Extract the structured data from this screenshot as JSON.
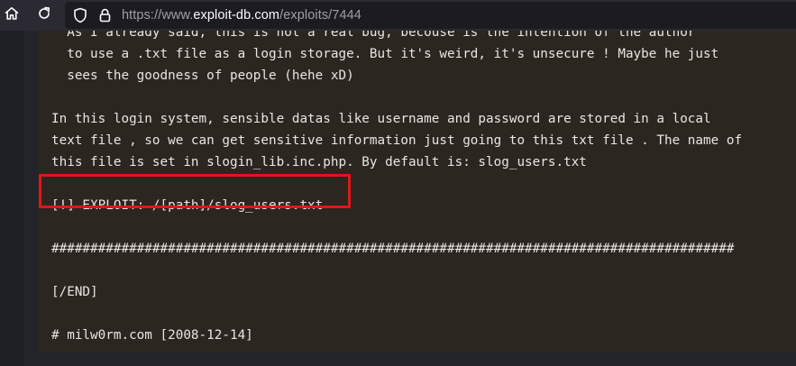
{
  "browser": {
    "url_prefix": "https://www.",
    "url_host": "exploit-db.com",
    "url_path": "/exploits/7444"
  },
  "code": {
    "lines": [
      "  As I already said, this is not a real bug, becouse is the intention of the author",
      "  to use a .txt file as a login storage. But it's weird, it's unsecure ! Maybe he just",
      "  sees the goodness of people (hehe xD)",
      "",
      "In this login system, sensible datas like username and password are stored in a local",
      "text file , so we can get sensitive information just going to this txt file . The name of",
      "this file is set in slogin_lib.inc.php. By default is: slog_users.txt",
      "",
      "[!] EXPLOIT: /[path]/slog_users.txt",
      "",
      "########################################################################################",
      "",
      "[/END]",
      "",
      "# milw0rm.com [2008-12-14]"
    ]
  },
  "colors": {
    "highlight_border": "#e0161a",
    "code_background": "#2c2620",
    "code_text": "#e8e6e3"
  },
  "icons": {
    "home": "home-icon",
    "reload": "reload-icon",
    "shield": "shield-icon",
    "lock": "lock-icon"
  }
}
